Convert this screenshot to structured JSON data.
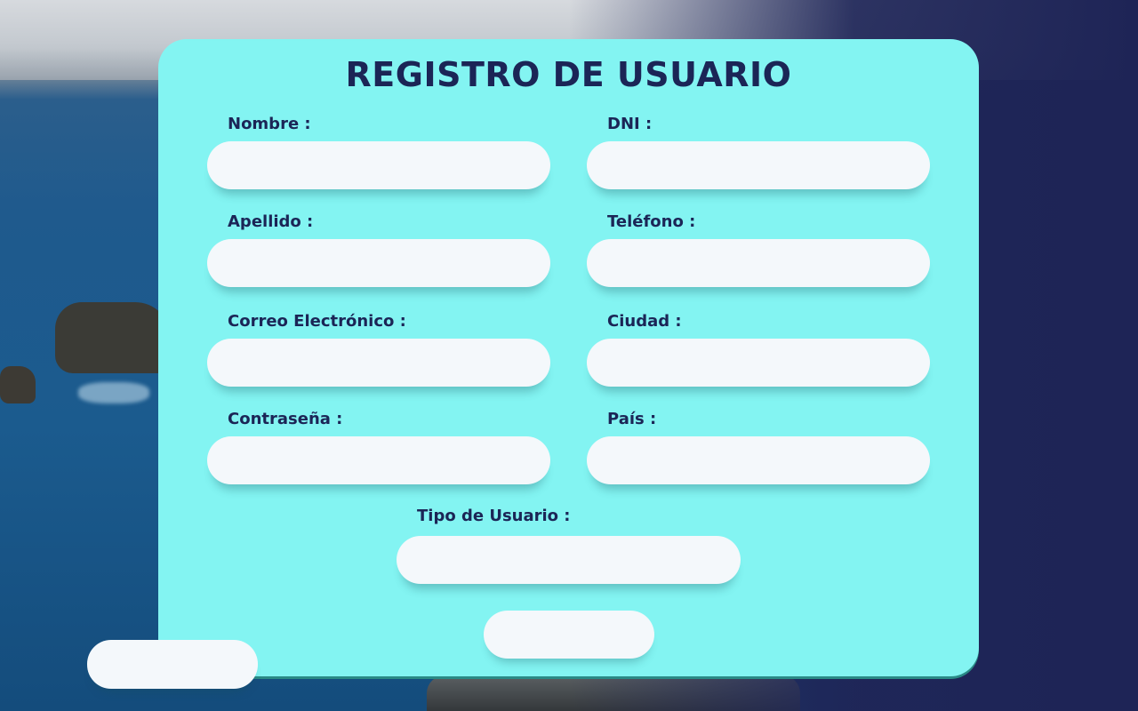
{
  "form": {
    "title": "REGISTRO DE USUARIO",
    "fields": {
      "nombre": {
        "label": "Nombre :",
        "value": ""
      },
      "dni": {
        "label": "DNI :",
        "value": ""
      },
      "apellido": {
        "label": "Apellido :",
        "value": ""
      },
      "telefono": {
        "label": "Teléfono :",
        "value": ""
      },
      "correo": {
        "label": "Correo Electrónico :",
        "value": ""
      },
      "ciudad": {
        "label": "Ciudad :",
        "value": ""
      },
      "contrasena": {
        "label": "Contraseña :",
        "value": ""
      },
      "pais": {
        "label": "País :",
        "value": ""
      },
      "tipo_usuario": {
        "label": "Tipo de Usuario :",
        "value": ""
      }
    },
    "submit_label": "",
    "back_label": ""
  },
  "colors": {
    "card": "#83f4f2",
    "text": "#1b2556",
    "field": "#f4f8fb",
    "background_right": "#1e2456"
  }
}
